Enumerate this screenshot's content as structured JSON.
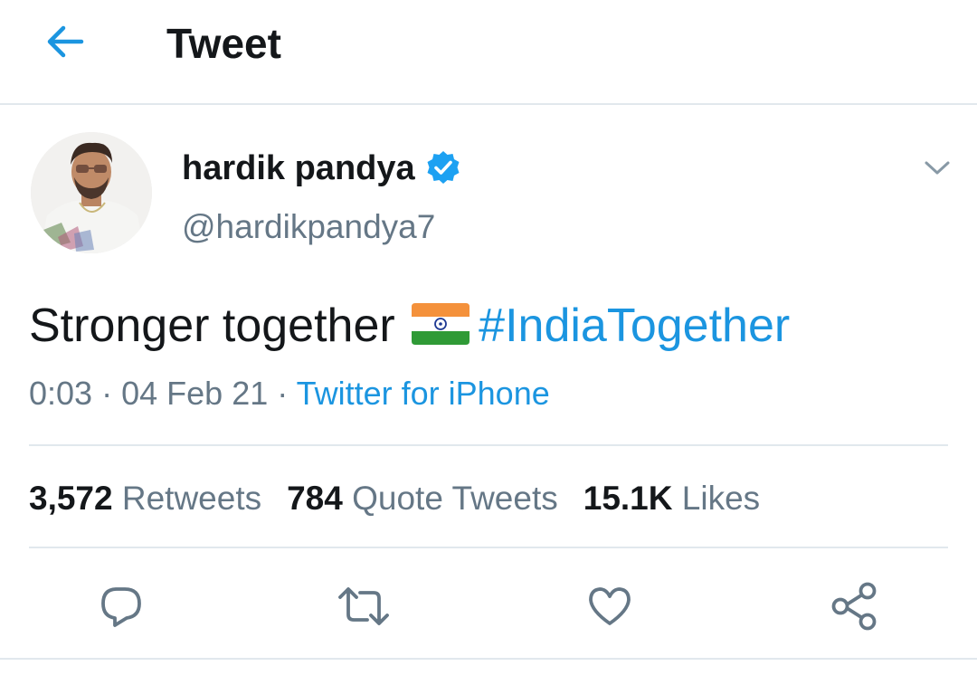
{
  "header": {
    "title": "Tweet",
    "back_icon": "arrow-left-icon"
  },
  "author": {
    "display_name": "hardik pandya",
    "handle": "@hardikpandya7",
    "verified": true
  },
  "tweet": {
    "text": "Stronger together",
    "emoji": "india-flag-icon",
    "hashtag": "#IndiaTogether",
    "time": "0:03",
    "date": "04 Feb 21",
    "separator": "·",
    "source": "Twitter for iPhone"
  },
  "stats": {
    "retweets_count": "3,572",
    "retweets_label": "Retweets",
    "quotes_count": "784",
    "quotes_label": "Quote Tweets",
    "likes_count": "15.1K",
    "likes_label": "Likes"
  },
  "actions": [
    "reply-icon",
    "retweet-icon",
    "like-icon",
    "share-icon"
  ],
  "colors": {
    "accent": "#1b95e0",
    "text_primary": "#14171a",
    "text_secondary": "#657786",
    "divider": "#e1e8ed"
  }
}
